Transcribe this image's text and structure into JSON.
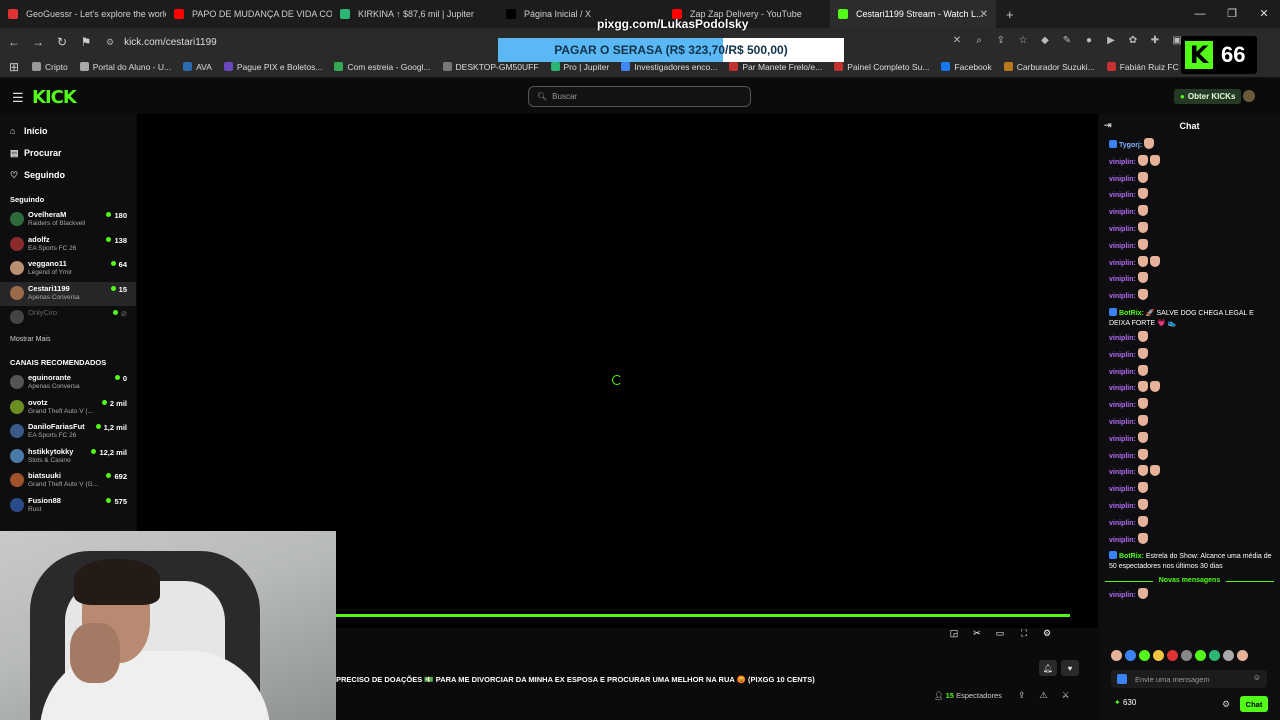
{
  "browser": {
    "tabs": [
      {
        "title": "GeoGuessr - Let's explore the world!",
        "icon": "map-pin-icon",
        "color": "#d33"
      },
      {
        "title": "PAPO DE MUDANÇA DE VIDA COM ...",
        "icon": "youtube-icon",
        "color": "#f00"
      },
      {
        "title": "KIRKINA ↑ $87,6 mil | Jupiter",
        "icon": "jupiter-icon",
        "color": "#2bb673"
      },
      {
        "title": "Página Inicial / X",
        "icon": "x-icon",
        "color": "#000"
      },
      {
        "title": "Zap Zap Delivery - YouTube",
        "icon": "youtube-icon",
        "color": "#f00"
      },
      {
        "title": "Cestari1199 Stream - Watch L...",
        "icon": "kick-icon",
        "color": "#53fc18",
        "active": true
      }
    ],
    "url": "kick.com/cestari1199",
    "bookmarks": [
      {
        "label": "Cripto",
        "color": "#999"
      },
      {
        "label": "Portal do Aluno - U...",
        "color": "#aaa"
      },
      {
        "label": "AVA",
        "color": "#2b6cb0"
      },
      {
        "label": "Pague PIX e Boletos...",
        "color": "#6b46c1"
      },
      {
        "label": "Com estreia - Googl...",
        "color": "#34a853"
      },
      {
        "label": "DESKTOP-GM50UFF",
        "color": "#777"
      },
      {
        "label": "Pro | Jupiter",
        "color": "#2bb673"
      },
      {
        "label": "Investigadores enco...",
        "color": "#4285f4"
      },
      {
        "label": "Par Manete Frelo/e...",
        "color": "#c53030"
      },
      {
        "label": "Painel Completo Su...",
        "color": "#c53030"
      },
      {
        "label": "Facebook",
        "color": "#1877f2"
      },
      {
        "label": "Carburador Suzuki...",
        "color": "#b7791f"
      },
      {
        "label": "Fabián Ruiz FC Pro L...",
        "color": "#c53030"
      }
    ]
  },
  "overlay": {
    "pix_user": "pixgg.com/LukasPodolsky",
    "serasa_text": "PAGAR O SERASA (R$ 323,70/R$ 500,00)",
    "serasa_progress": 0.647,
    "kick_counter": "66"
  },
  "kick": {
    "logo": "KICK",
    "search_placeholder": "Buscar",
    "get_kicks": "Obter KICKs",
    "nav": [
      {
        "label": "Início",
        "icon": "home-icon",
        "glyph": "⌂"
      },
      {
        "label": "Procurar",
        "icon": "browse-icon",
        "glyph": "▤"
      },
      {
        "label": "Seguindo",
        "icon": "heart-icon",
        "glyph": "♡"
      }
    ],
    "following_title": "Seguindo",
    "following": [
      {
        "name": "OvelheraM",
        "category": "Raiders of Blackveil",
        "viewers": "180",
        "color": "#2f6b3a"
      },
      {
        "name": "adolfz",
        "category": "EA Sports FC 26",
        "viewers": "138",
        "color": "#8b2a2a"
      },
      {
        "name": "veggano11",
        "category": "Legend of Ymir",
        "viewers": "64",
        "color": "#b89070"
      },
      {
        "name": "Cestari1199",
        "category": "Apenas Conversa",
        "viewers": "15",
        "color": "#9b6a4a",
        "selected": true
      },
      {
        "name": "OnlyCiro",
        "category": "",
        "viewers": "",
        "color": "#444",
        "offline": true
      }
    ],
    "show_more": "Mostrar Mais",
    "recommended_title": "CANAIS RECOMENDADOS",
    "recommended": [
      {
        "name": "eguinorante",
        "category": "Apenas Conversa",
        "viewers": "0",
        "color": "#555"
      },
      {
        "name": "ovotz",
        "category": "Grand Theft Auto V (...",
        "viewers": "2 mil",
        "color": "#6b8e23"
      },
      {
        "name": "DaniloFariasFut",
        "category": "EA Sports FC 26",
        "viewers": "1,2 mil",
        "color": "#3a5a8a"
      },
      {
        "name": "hstikkytokky",
        "category": "Slots & Casino",
        "viewers": "12,2 mil",
        "color": "#4a7aa8"
      },
      {
        "name": "biatsuuki",
        "category": "Grand Theft Auto V (G...",
        "viewers": "692",
        "color": "#a0522d"
      },
      {
        "name": "Fusion88",
        "category": "Rust",
        "viewers": "575",
        "color": "#2b4a8a"
      }
    ],
    "scroll_text": "PRECISO DE DOAÇÕES 💵 PARA ME DIVORCIAR DA MINHA EX ESPOSA E PROCURAR UMA MELHOR NA RUA 😡 (PIXGG 10 CENTS)",
    "viewers_count": "15",
    "viewers_label": "Espectadores"
  },
  "chat": {
    "title": "Chat",
    "messages": [
      {
        "user": "Tygorj:",
        "type": "t",
        "emotes": 1
      },
      {
        "user": "viniplin:",
        "type": "u",
        "emotes": 2
      },
      {
        "user": "viniplin:",
        "type": "u",
        "emotes": 1
      },
      {
        "user": "viniplin:",
        "type": "u",
        "emotes": 1
      },
      {
        "user": "viniplin:",
        "type": "u",
        "emotes": 1
      },
      {
        "user": "viniplin:",
        "type": "u",
        "emotes": 1
      },
      {
        "user": "viniplin:",
        "type": "u",
        "emotes": 1
      },
      {
        "user": "viniplin:",
        "type": "u",
        "emotes": 2
      },
      {
        "user": "viniplin:",
        "type": "u",
        "emotes": 1
      },
      {
        "user": "viniplin:",
        "type": "u",
        "emotes": 1
      },
      {
        "user": "BotRix:",
        "type": "b",
        "text": "🚀 SALVE DOG CHEGA LEGAL E DEIXA FORTE 💗 👟"
      },
      {
        "user": "viniplin:",
        "type": "u",
        "emotes": 1
      },
      {
        "user": "viniplin:",
        "type": "u",
        "emotes": 1
      },
      {
        "user": "viniplin:",
        "type": "u",
        "emotes": 1
      },
      {
        "user": "viniplin:",
        "type": "u",
        "emotes": 2
      },
      {
        "user": "viniplin:",
        "type": "u",
        "emotes": 1
      },
      {
        "user": "viniplin:",
        "type": "u",
        "emotes": 1
      },
      {
        "user": "viniplin:",
        "type": "u",
        "emotes": 1
      },
      {
        "user": "viniplin:",
        "type": "u",
        "emotes": 1
      },
      {
        "user": "viniplin:",
        "type": "u",
        "emotes": 2
      },
      {
        "user": "viniplin:",
        "type": "u",
        "emotes": 1
      },
      {
        "user": "viniplin:",
        "type": "u",
        "emotes": 1
      },
      {
        "user": "viniplin:",
        "type": "u",
        "emotes": 1
      },
      {
        "user": "viniplin:",
        "type": "u",
        "emotes": 1
      },
      {
        "user": "BotRix:",
        "type": "b",
        "text": "Estrela do Show: Alcance uma média de 50 espectadores nos últimos 30 dias"
      }
    ],
    "new_messages_label": "Novas mensagens",
    "after_messages": [
      {
        "user": "viniplin:",
        "type": "u",
        "emotes": 1
      }
    ],
    "input_placeholder": "Envie uma mensagem",
    "points": "630",
    "chat_button": "Chat"
  }
}
